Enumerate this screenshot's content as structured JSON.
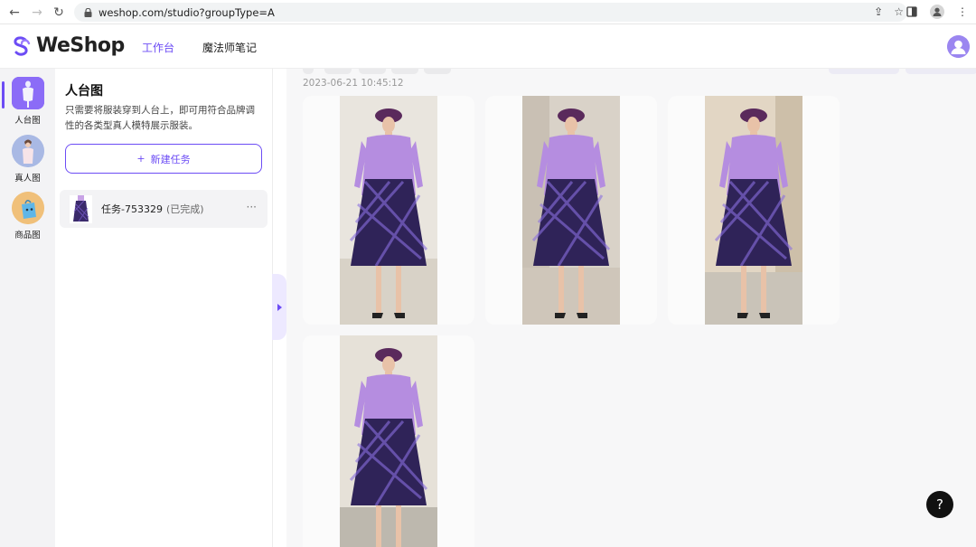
{
  "browser": {
    "url": "weshop.com/studio?groupType=A"
  },
  "header": {
    "brand": "WeShop",
    "nav": [
      {
        "label": "工作台",
        "active": true
      },
      {
        "label": "魔法师笔记",
        "active": false
      }
    ]
  },
  "rail": {
    "items": [
      {
        "label": "人台图",
        "active": true
      },
      {
        "label": "真人图",
        "active": false
      },
      {
        "label": "商品图",
        "active": false
      }
    ]
  },
  "panel": {
    "title": "人台图",
    "description": "只需要将服装穿到人台上，即可用符合品牌调性的各类型真人模特展示服装。",
    "new_task_icon": "+",
    "new_task_label": "新建任务",
    "tasks": [
      {
        "name": "任务-753329",
        "status": "(已完成)",
        "more": "···"
      }
    ]
  },
  "main": {
    "timestamp": "2023-06-21 10:45:12"
  },
  "help": {
    "label": "?"
  },
  "colors": {
    "accent": "#6c4cf5",
    "blouse": "#b58de0",
    "skirt": "#2f2358",
    "hat": "#5a2a5c"
  }
}
